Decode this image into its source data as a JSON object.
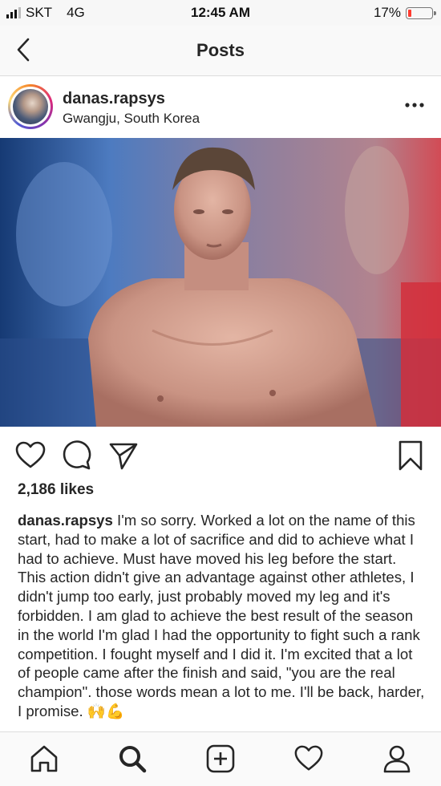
{
  "status_bar": {
    "carrier": "SKT",
    "network": "4G",
    "time": "12:45 AM",
    "battery_percent": "17%",
    "battery_level": 0.17,
    "battery_color": "#ff3b30"
  },
  "nav": {
    "title": "Posts",
    "back_icon": "chevron-left-icon"
  },
  "post": {
    "username": "danas.rapsys",
    "location": "Gwangju, South Korea",
    "more_icon": "more-horizontal-icon",
    "image_subject": "swimmer-photo",
    "likes": "2,186 likes",
    "caption_user": "danas.rapsys",
    "caption_text": "I'm so sorry. Worked a lot on the name of this start, had to make a lot of sacrifice and did to achieve what I had to achieve. Must have moved his leg before the start. This action didn't give an advantage against other athletes, I didn't jump too early, just probably moved my leg and it's forbidden. I am glad to achieve the best result of the season in the world I'm glad I had the opportunity to fight such a rank competition. I fought myself and I did it. I'm excited that a lot of people came after the finish and said, \"you are the real champion\". those words mean a lot to me. I'll be back, harder, I promise. 🙌💪"
  },
  "actions": {
    "like_icon": "heart-icon",
    "comment_icon": "comment-icon",
    "share_icon": "send-icon",
    "save_icon": "bookmark-icon"
  },
  "tab_bar": {
    "items": [
      "home-icon",
      "search-icon",
      "new-post-icon",
      "activity-heart-icon",
      "profile-icon"
    ]
  }
}
